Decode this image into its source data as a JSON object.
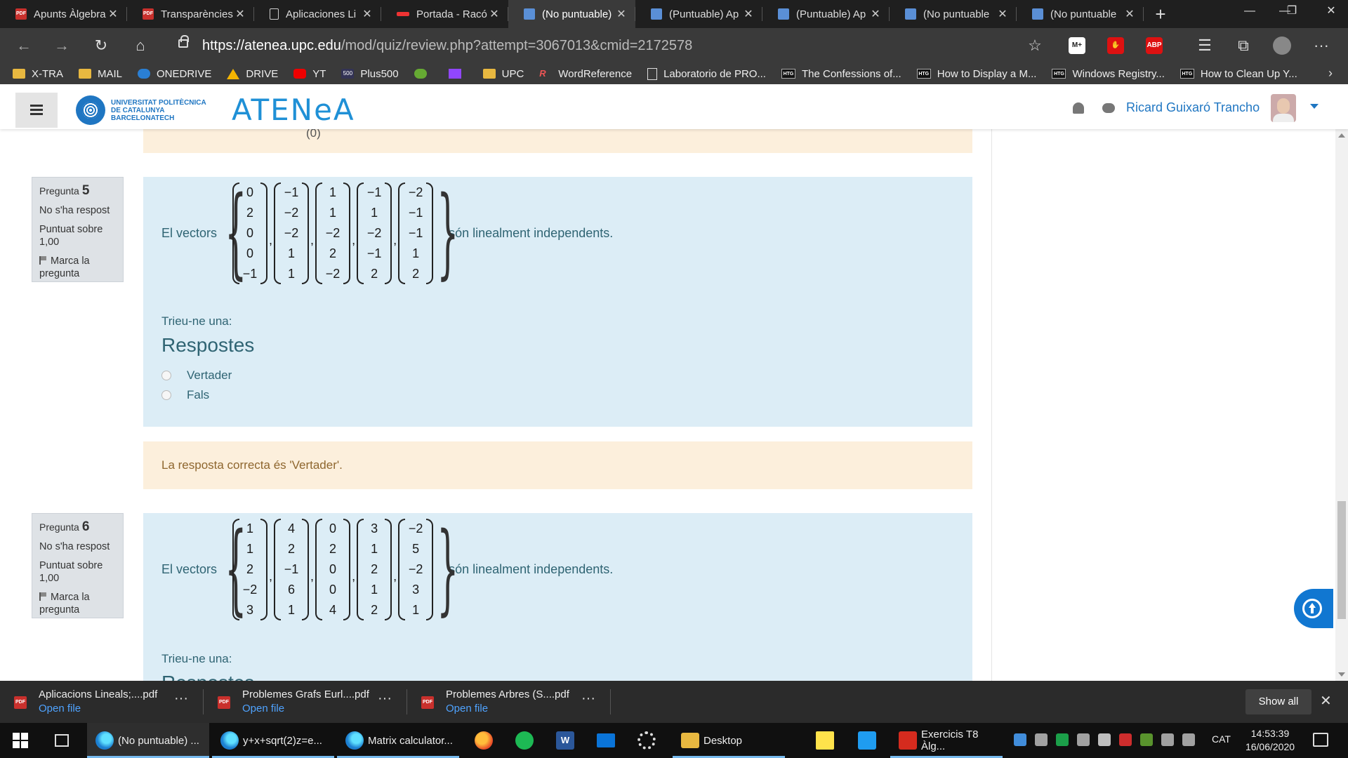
{
  "browser": {
    "tabs": [
      {
        "title": "Apunts Àlgebra",
        "icon": "pdf-icon"
      },
      {
        "title": "Transparències",
        "icon": "pdf-icon"
      },
      {
        "title": "Aplicaciones Li",
        "icon": "page-icon"
      },
      {
        "title": "Portada - Racó",
        "icon": "upc-icon"
      },
      {
        "title": "(No puntuable)",
        "icon": "atenea-icon",
        "active": true
      },
      {
        "title": "(Puntuable) Ap",
        "icon": "atenea-icon"
      },
      {
        "title": "(Puntuable) Ap",
        "icon": "atenea-icon"
      },
      {
        "title": "(No puntuable",
        "icon": "atenea-icon"
      },
      {
        "title": "(No puntuable",
        "icon": "atenea-icon"
      }
    ],
    "close_glyph": "✕",
    "new_tab_glyph": "+",
    "window_controls": {
      "minimize": "—",
      "maximize": "❐",
      "close": "✕"
    },
    "url_host": "https://atenea.upc.edu",
    "url_rest": "/mod/quiz/review.php?attempt=3067013&cmid=2172578",
    "extensions": [
      {
        "label": "M+",
        "color": "#ffffff",
        "text_color": "#222222"
      },
      {
        "label": "✋",
        "color": "#d11",
        "text_color": "#ffffff"
      },
      {
        "label": "ABP",
        "color": "#d11",
        "text_color": "#ffffff"
      }
    ],
    "nav": {
      "back": "←",
      "forward": "→",
      "reload": "↻",
      "home": "⌂",
      "star": "☆",
      "favorites": "☰",
      "collections": "⧉",
      "menu": "···"
    },
    "bookmarks": [
      {
        "label": "X-TRA",
        "icon": "folder"
      },
      {
        "label": "MAIL",
        "icon": "folder"
      },
      {
        "label": "ONEDRIVE",
        "icon": "onedrive"
      },
      {
        "label": "DRIVE",
        "icon": "drive"
      },
      {
        "label": "YT",
        "icon": "yt"
      },
      {
        "label": "Plus500",
        "icon": "plus"
      },
      {
        "label": "",
        "icon": "green"
      },
      {
        "label": "",
        "icon": "twitch"
      },
      {
        "label": "UPC",
        "icon": "folder"
      },
      {
        "label": "WordReference",
        "icon": "wr"
      },
      {
        "label": "Laboratorio de PRO...",
        "icon": "page"
      },
      {
        "label": "The Confessions of...",
        "icon": "htg"
      },
      {
        "label": "How to Display a M...",
        "icon": "htg"
      },
      {
        "label": "Windows Registry...",
        "icon": "htg"
      },
      {
        "label": "How to Clean Up Y...",
        "icon": "htg"
      }
    ],
    "bookmarks_more": "›"
  },
  "site": {
    "upc_text": [
      "UNIVERSITAT POLITÈCNICA",
      "DE CATALUNYA",
      "BARCELONATECH"
    ],
    "atenea_logo": "ATENeA",
    "user_name": "Ricard Guixaró Trancho",
    "brand_color": "#1f76c2"
  },
  "questions": [
    {
      "label": "Pregunta",
      "number": "5",
      "status": "No s'ha respost",
      "score": "Puntuat sobre 1,00",
      "flag": "Marca la pregunta",
      "intro": "El vectors",
      "outro": "són linealment independents.",
      "vectors": [
        [
          "0",
          "2",
          "0",
          "0",
          "−1"
        ],
        [
          "−1",
          "−2",
          "−2",
          "1",
          "1"
        ],
        [
          "1",
          "1",
          "−2",
          "2",
          "−2"
        ],
        [
          "−1",
          "1",
          "−2",
          "−1",
          "2"
        ],
        [
          "−2",
          "−1",
          "−1",
          "1",
          "2"
        ]
      ],
      "prompt": "Trieu-ne una:",
      "answers_title": "Respostes",
      "options": [
        "Vertader",
        "Fals"
      ],
      "feedback": "La resposta correcta és 'Vertader'."
    },
    {
      "label": "Pregunta",
      "number": "6",
      "status": "No s'ha respost",
      "score": "Puntuat sobre 1,00",
      "flag": "Marca la pregunta",
      "intro": "El vectors",
      "outro": "són linealment independents.",
      "vectors": [
        [
          "1",
          "1",
          "2",
          "−2",
          "3"
        ],
        [
          "4",
          "2",
          "−1",
          "6",
          "1"
        ],
        [
          "0",
          "2",
          "0",
          "0",
          "4"
        ],
        [
          "3",
          "1",
          "2",
          "1",
          "2"
        ],
        [
          "−2",
          "5",
          "−2",
          "3",
          "1"
        ]
      ],
      "prompt": "Trieu-ne una:",
      "answers_title": "Respostes"
    }
  ],
  "top_partial_glyph": "(0)",
  "downloads": {
    "items": [
      {
        "name": "Aplicacions Lineals;....pdf",
        "action": "Open file"
      },
      {
        "name": "Problemes Grafs Eurl....pdf",
        "action": "Open file"
      },
      {
        "name": "Problemes Arbres (S....pdf",
        "action": "Open file"
      }
    ],
    "more_glyph": "···",
    "show_all": "Show all",
    "close_glyph": "✕"
  },
  "taskbar": {
    "windows": [
      {
        "label": "(No puntuable) ...",
        "icon": "edge"
      },
      {
        "label": "y+x+sqrt(2)z=e...",
        "icon": "edge"
      },
      {
        "label": "Matrix calculator...",
        "icon": "edge"
      }
    ],
    "pinned": [
      "firefox",
      "spotify",
      "word",
      "mail",
      "settings"
    ],
    "explorer_label": "Desktop",
    "acrobat_label": "Exercicis T8 Àlg...",
    "word_letter": "W",
    "language": "CAT",
    "time": "14:53:39",
    "date": "16/06/2020"
  }
}
